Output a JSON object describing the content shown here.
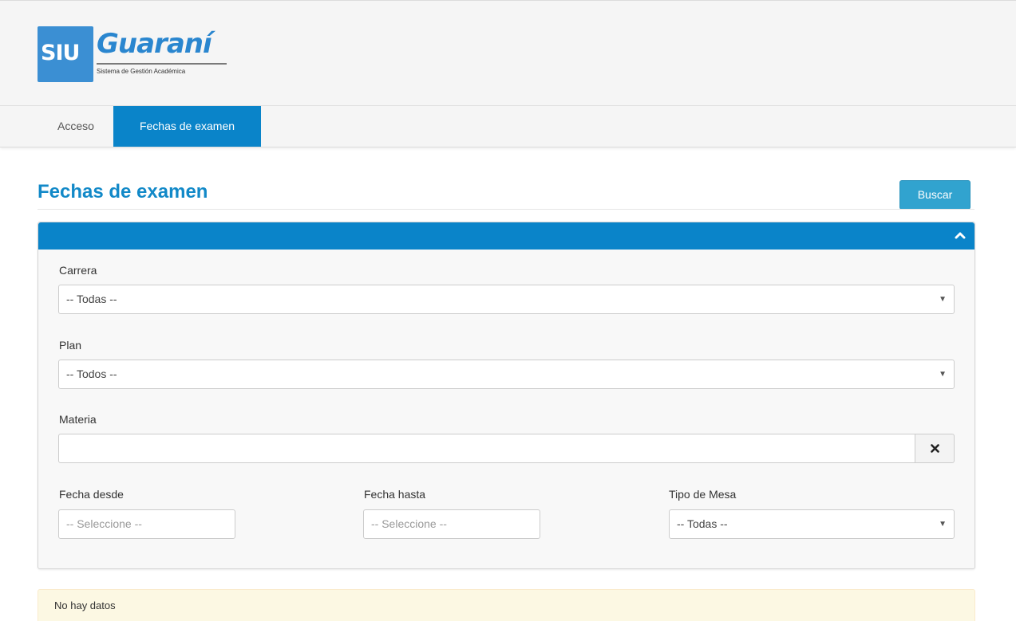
{
  "header": {
    "logo": {
      "mark": "SIU",
      "name": "Guaraní",
      "subtitle": "Sistema de Gestión Académica"
    }
  },
  "nav": {
    "items": [
      {
        "label": "Acceso",
        "active": false
      },
      {
        "label": "Fechas de examen",
        "active": true
      }
    ]
  },
  "page": {
    "title": "Fechas de examen",
    "search_button": "Buscar"
  },
  "filters": {
    "carrera": {
      "label": "Carrera",
      "value": "-- Todas --"
    },
    "plan": {
      "label": "Plan",
      "value": "-- Todos --"
    },
    "materia": {
      "label": "Materia",
      "value": ""
    },
    "fecha_desde": {
      "label": "Fecha desde",
      "placeholder": "-- Seleccione --"
    },
    "fecha_hasta": {
      "label": "Fecha hasta",
      "placeholder": "-- Seleccione --"
    },
    "tipo_mesa": {
      "label": "Tipo de Mesa",
      "value": "-- Todas --"
    }
  },
  "results": {
    "message": "No hay datos"
  },
  "colors": {
    "primary": "#0a84c9",
    "title": "#1289c8",
    "button": "#31a3cf",
    "alert_bg": "#fcf8e3"
  },
  "icons": {
    "panel_toggle": "chevron-up-icon",
    "clear": "close-icon",
    "select_caret": "caret-down-icon"
  }
}
